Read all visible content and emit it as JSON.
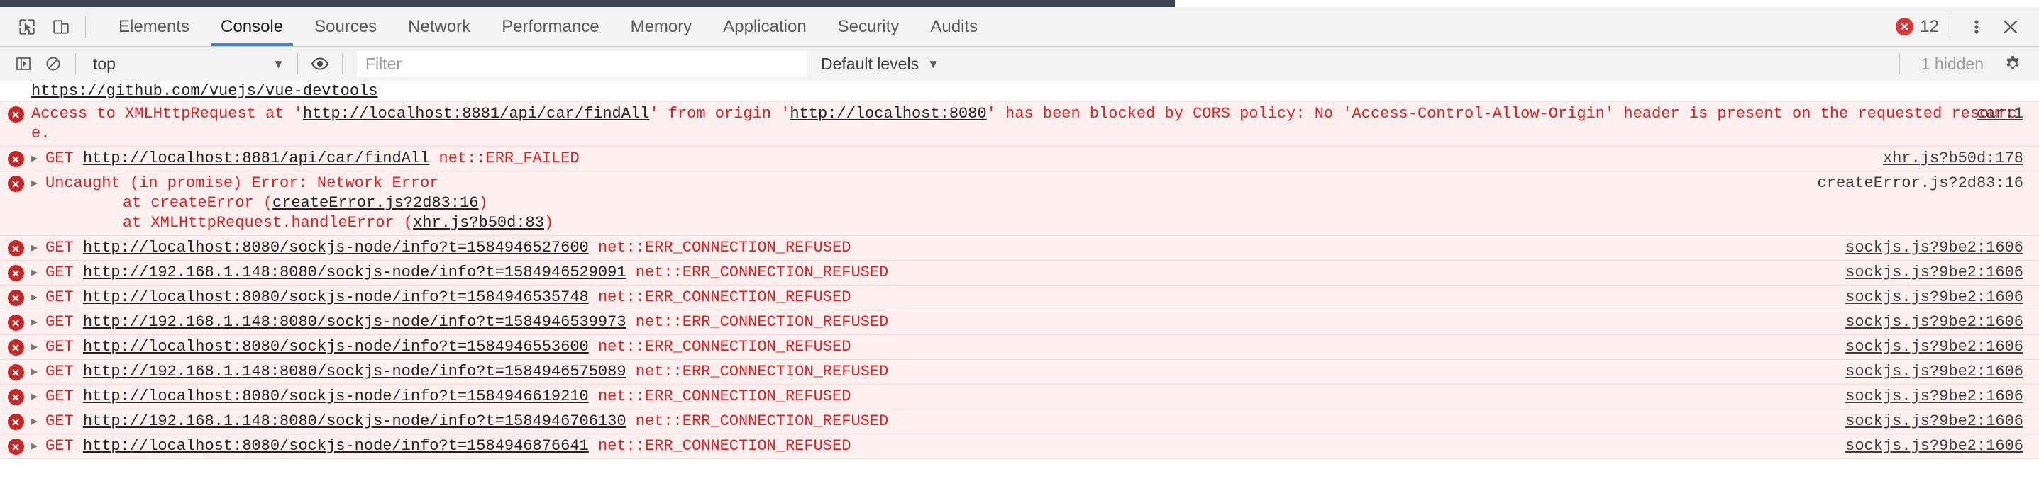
{
  "window": {
    "titlebar_color": "#3b4252"
  },
  "toolbar": {
    "inspect_icon": "cursor-inspect-icon",
    "device_icon": "device-toolbar-icon",
    "tabs": [
      {
        "label": "Elements",
        "selected": false
      },
      {
        "label": "Console",
        "selected": true
      },
      {
        "label": "Sources",
        "selected": false
      },
      {
        "label": "Network",
        "selected": false
      },
      {
        "label": "Performance",
        "selected": false
      },
      {
        "label": "Memory",
        "selected": false
      },
      {
        "label": "Application",
        "selected": false
      },
      {
        "label": "Security",
        "selected": false
      },
      {
        "label": "Audits",
        "selected": false
      }
    ],
    "error_count": "12",
    "error_icon": "error-circle-icon",
    "more_icon": "kebab-menu-icon",
    "close_icon": "close-icon",
    "accent_color": "#3b7ff0",
    "error_color": "#e03434"
  },
  "filterbar": {
    "sidebar_icon": "console-sidebar-icon",
    "clear_icon": "clear-console-icon",
    "context": "top",
    "context_caret": "▼",
    "eye_icon": "live-expression-icon",
    "filter_placeholder": "Filter",
    "filter_value": "",
    "levels_label": "Default levels",
    "levels_caret": "▼",
    "hidden_label": "1 hidden",
    "settings_icon": "gear-icon"
  },
  "console": {
    "clipped_top_link": "https://github.com/vuejs/vue-devtools",
    "messages": [
      {
        "kind": "cors-error",
        "icon": "error-circle-icon",
        "expandable": false,
        "text_1": "Access to XMLHttpRequest at '",
        "link_1": "http://localhost:8881/api/car/findAll",
        "text_2": "' from origin '",
        "link_2": "http://localhost:8080",
        "text_3": "' has been blocked by CORS policy: No 'Access-Control-Allow-Origin' header is present on the requested resource.",
        "source": "car:1"
      },
      {
        "kind": "network-error",
        "icon": "error-circle-icon",
        "expandable": true,
        "method": "GET",
        "url": "http://localhost:8881/api/car/findAll",
        "status": "net::ERR_FAILED",
        "source": "xhr.js?b50d:178"
      },
      {
        "kind": "uncaught-error",
        "icon": "error-circle-icon",
        "expandable": true,
        "title": "Uncaught (in promise) Error: Network Error",
        "stack": [
          "at createError (createError.js?2d83:16)",
          "at XMLHttpRequest.handleError (xhr.js?b50d:83)"
        ],
        "stack_links": [
          "createError.js?2d83:16",
          "xhr.js?b50d:83"
        ],
        "source": "createError.js?2d83:16"
      },
      {
        "kind": "network-error",
        "icon": "error-circle-icon",
        "expandable": true,
        "method": "GET",
        "url": "http://localhost:8080/sockjs-node/info?t=1584946527600",
        "status": "net::ERR_CONNECTION_REFUSED",
        "source": "sockjs.js?9be2:1606"
      },
      {
        "kind": "network-error",
        "icon": "error-circle-icon",
        "expandable": true,
        "method": "GET",
        "url": "http://192.168.1.148:8080/sockjs-node/info?t=1584946529091",
        "status": "net::ERR_CONNECTION_REFUSED",
        "source": "sockjs.js?9be2:1606"
      },
      {
        "kind": "network-error",
        "icon": "error-circle-icon",
        "expandable": true,
        "method": "GET",
        "url": "http://localhost:8080/sockjs-node/info?t=1584946535748",
        "status": "net::ERR_CONNECTION_REFUSED",
        "source": "sockjs.js?9be2:1606"
      },
      {
        "kind": "network-error",
        "icon": "error-circle-icon",
        "expandable": true,
        "method": "GET",
        "url": "http://192.168.1.148:8080/sockjs-node/info?t=1584946539973",
        "status": "net::ERR_CONNECTION_REFUSED",
        "source": "sockjs.js?9be2:1606"
      },
      {
        "kind": "network-error",
        "icon": "error-circle-icon",
        "expandable": true,
        "method": "GET",
        "url": "http://localhost:8080/sockjs-node/info?t=1584946553600",
        "status": "net::ERR_CONNECTION_REFUSED",
        "source": "sockjs.js?9be2:1606"
      },
      {
        "kind": "network-error",
        "icon": "error-circle-icon",
        "expandable": true,
        "method": "GET",
        "url": "http://192.168.1.148:8080/sockjs-node/info?t=1584946575089",
        "status": "net::ERR_CONNECTION_REFUSED",
        "source": "sockjs.js?9be2:1606"
      },
      {
        "kind": "network-error",
        "icon": "error-circle-icon",
        "expandable": true,
        "method": "GET",
        "url": "http://localhost:8080/sockjs-node/info?t=1584946619210",
        "status": "net::ERR_CONNECTION_REFUSED",
        "source": "sockjs.js?9be2:1606"
      },
      {
        "kind": "network-error",
        "icon": "error-circle-icon",
        "expandable": true,
        "method": "GET",
        "url": "http://192.168.1.148:8080/sockjs-node/info?t=1584946706130",
        "status": "net::ERR_CONNECTION_REFUSED",
        "source": "sockjs.js?9be2:1606"
      },
      {
        "kind": "network-error",
        "icon": "error-circle-icon",
        "expandable": true,
        "method": "GET",
        "url": "http://localhost:8080/sockjs-node/info?t=1584946876641",
        "status": "net::ERR_CONNECTION_REFUSED",
        "source": "sockjs.js?9be2:1606"
      }
    ]
  }
}
